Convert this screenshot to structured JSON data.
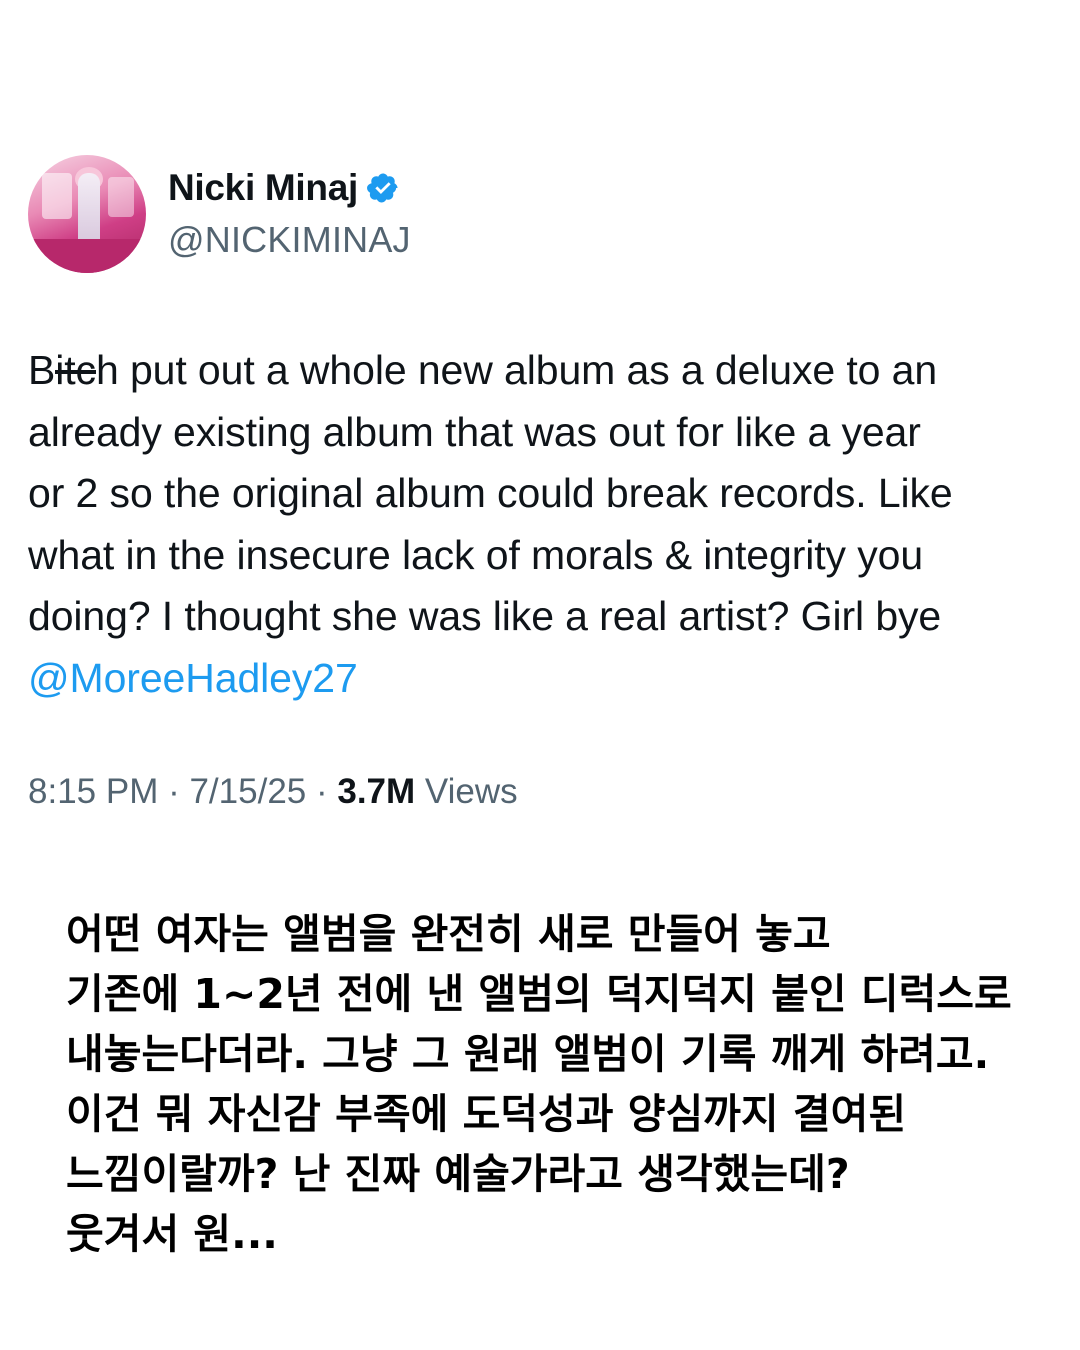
{
  "author": {
    "name": "Nicki Minaj",
    "handle": "@NICKIMINAJ",
    "avatar_icon": "profile-photo",
    "verified_icon": "verified-badge-icon",
    "verified_color": "#1d9bf0"
  },
  "tweet": {
    "lines": [
      {
        "pre": "B",
        "censored": "itc",
        "post": "h put out a whole new album as a deluxe to an"
      },
      {
        "text": "already existing album that was out for like a year"
      },
      {
        "text": "or 2 so the original album could break records. Like"
      },
      {
        "text": "what in the insecure lack of morals & integrity you"
      },
      {
        "text": "doing? I thought she was like a real artist? Girl bye"
      }
    ],
    "mention": "@MoreeHadley27",
    "mention_color": "#1d9bf0"
  },
  "meta": {
    "time": "8:15 PM",
    "separator": " · ",
    "date": "7/15/25",
    "views_count": "3.7M",
    "views_label": " Views"
  },
  "translation": {
    "lines": [
      "어떤 여자는 앨범을 완전히 새로 만들어 놓고",
      "기존에 1~2년 전에 낸 앨범의 덕지덕지 붙인 디럭스로",
      "내놓는다더라. 그냥 그 원래 앨범이 기록 깨게 하려고.",
      "이건 뭐 자신감 부족에 도덕성과 양심까지 결여된",
      "느낌이랄까? 난 진짜 예술가라고 생각했는데?",
      "웃겨서 원..."
    ]
  }
}
